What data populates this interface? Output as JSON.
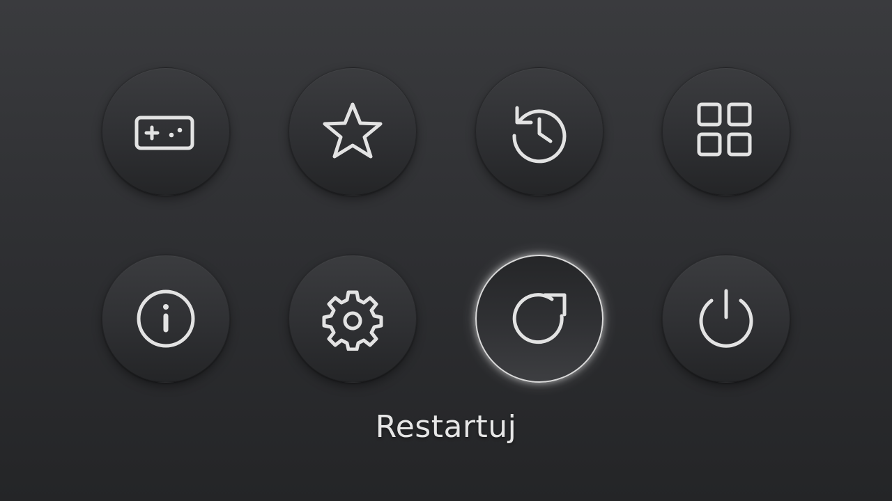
{
  "menu": {
    "items": [
      {
        "id": "games",
        "icon": "gamepad-icon",
        "selected": false
      },
      {
        "id": "favorites",
        "icon": "star-icon",
        "selected": false
      },
      {
        "id": "history",
        "icon": "history-icon",
        "selected": false
      },
      {
        "id": "apps",
        "icon": "grid-icon",
        "selected": false
      },
      {
        "id": "info",
        "icon": "info-icon",
        "selected": false
      },
      {
        "id": "settings",
        "icon": "gear-icon",
        "selected": false
      },
      {
        "id": "restart",
        "icon": "restart-icon",
        "selected": true
      },
      {
        "id": "power",
        "icon": "power-icon",
        "selected": false
      }
    ],
    "selected_label": "Restartuj"
  },
  "colors": {
    "icon": "#e3e3e3",
    "highlight_ring": "#d9d9d9",
    "label": "#e6e6e6"
  }
}
